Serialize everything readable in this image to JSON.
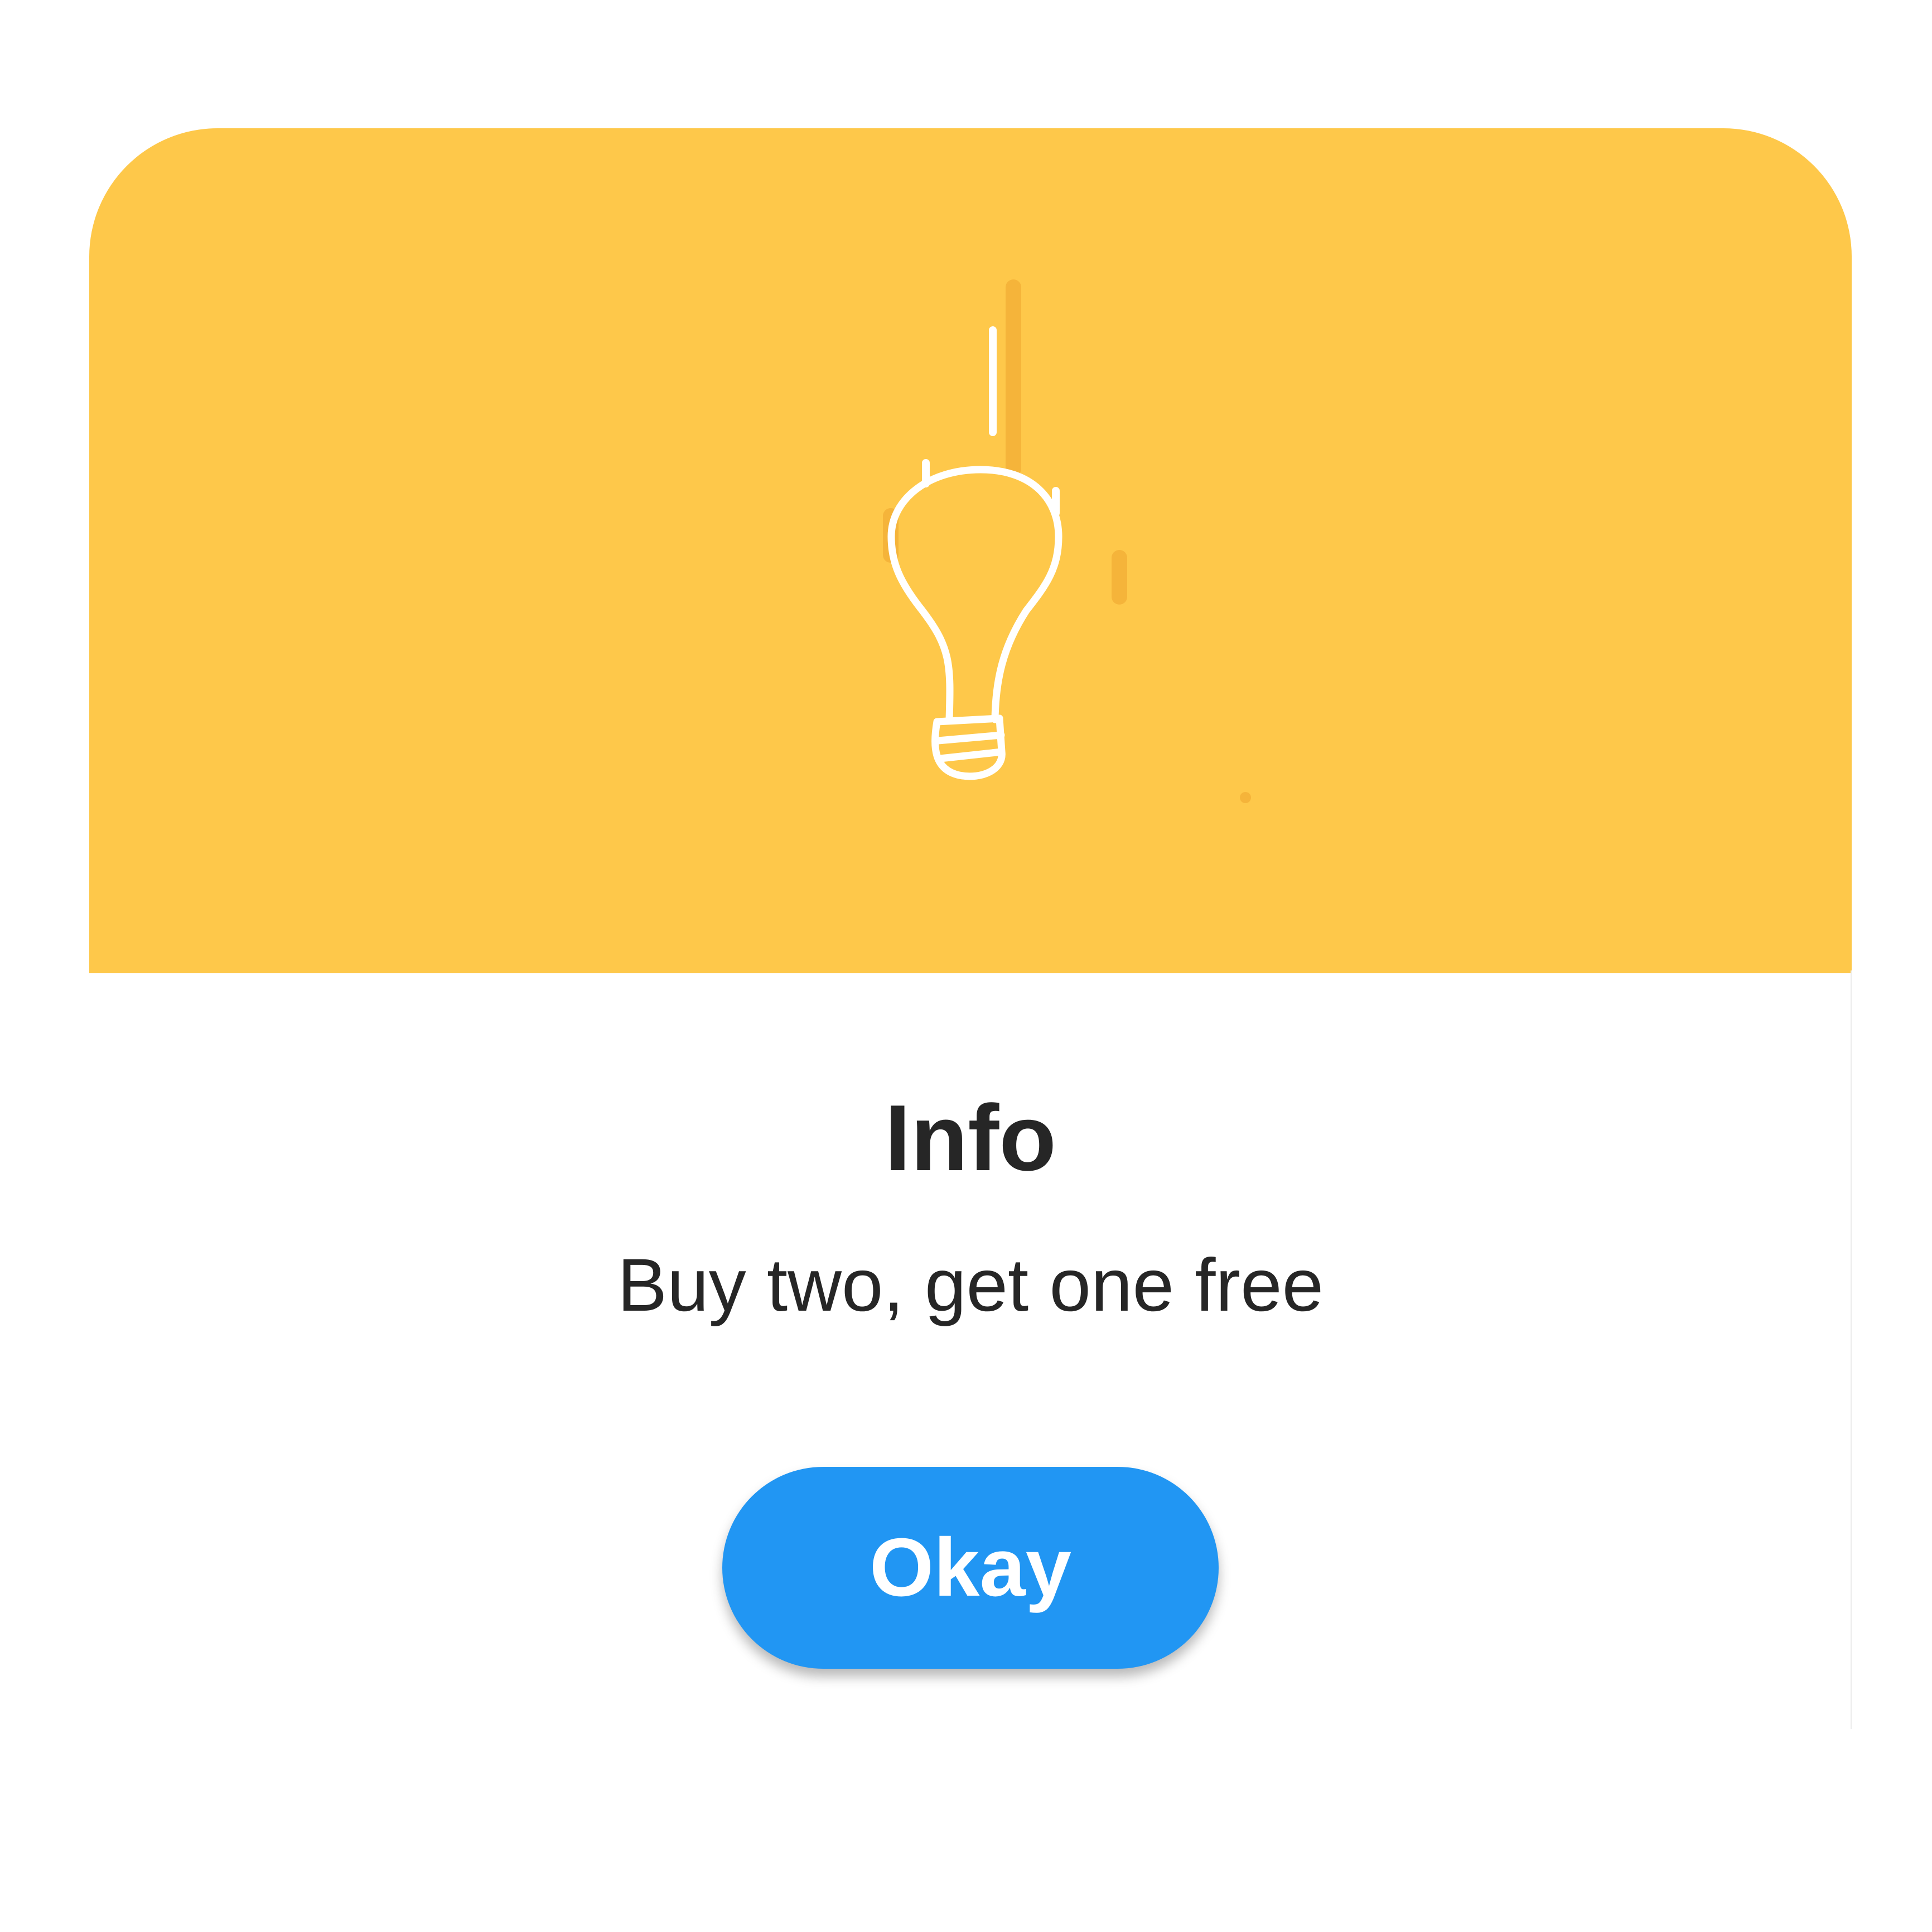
{
  "dialog": {
    "title": "Info",
    "message": "Buy two, get one free",
    "okay_label": "Okay"
  },
  "colors": {
    "header": "#fec84a",
    "accent_stroke": "#f5b43a",
    "button": "#2196f3",
    "text": "#262626"
  },
  "icons": {
    "header_icon": "lightbulb-icon"
  }
}
